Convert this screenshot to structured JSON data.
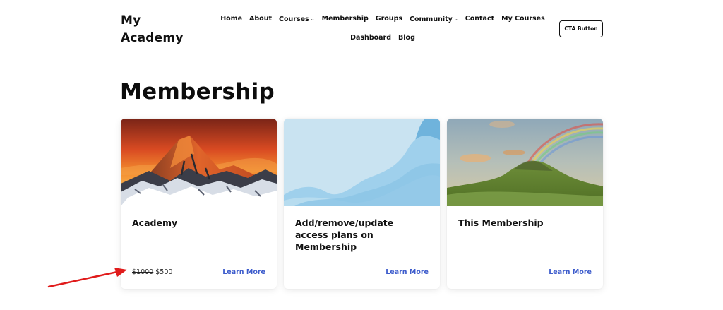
{
  "site": {
    "logo": "My Academy"
  },
  "nav": {
    "items": [
      {
        "label": "Home",
        "has_dropdown": false
      },
      {
        "label": "About",
        "has_dropdown": false
      },
      {
        "label": "Courses",
        "has_dropdown": true
      },
      {
        "label": "Membership",
        "has_dropdown": false
      },
      {
        "label": "Groups",
        "has_dropdown": false
      },
      {
        "label": "Community",
        "has_dropdown": true
      },
      {
        "label": "Contact",
        "has_dropdown": false
      },
      {
        "label": "My Courses",
        "has_dropdown": false
      },
      {
        "label": "Dashboard",
        "has_dropdown": false
      },
      {
        "label": "Blog",
        "has_dropdown": false
      }
    ],
    "caret": "⌄",
    "cta_label": "CTA Button"
  },
  "page": {
    "title": "Membership"
  },
  "cards": [
    {
      "title": "Academy",
      "old_price": "$1000",
      "price": "$500",
      "link": "Learn More",
      "image": "mountain-sunset"
    },
    {
      "title": "Add/remove/update access plans on Membership",
      "old_price": "",
      "price": "",
      "link": "Learn More",
      "image": "abstract-blue-waves"
    },
    {
      "title": "This Membership",
      "old_price": "",
      "price": "",
      "link": "Learn More",
      "image": "hill-rainbow"
    }
  ],
  "colors": {
    "link": "#3d5ccc",
    "arrow": "#e01b1b",
    "text": "#111111"
  }
}
